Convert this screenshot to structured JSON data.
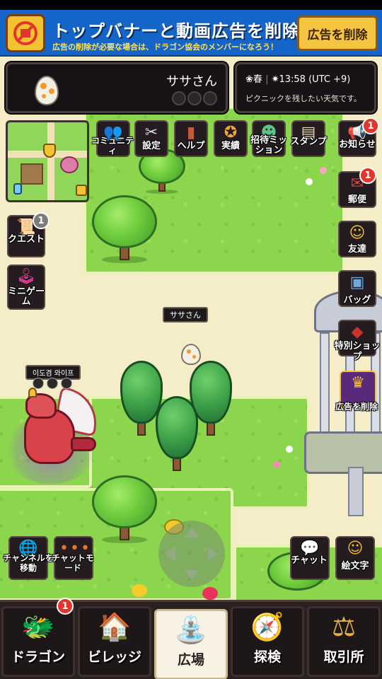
{
  "status_bar": {},
  "ad_banner": {
    "title": "トップバナーと動画広告を削除！",
    "subtitle": "広告の削除が必要な場合は、ドラゴン協会のメンバーになろう！",
    "remove_button": "広告を削除",
    "icon": "no-ads-icon"
  },
  "player": {
    "name": "ササさん",
    "avatar": "egg-icon",
    "map_tag": "ササさん"
  },
  "weather": {
    "season": "春",
    "time": "13:58 (UTC +9)",
    "description": "ピクニックを残したい天気です。"
  },
  "top_menu": [
    {
      "name": "community",
      "label": "コミュニティ",
      "icon": "people-icon"
    },
    {
      "name": "settings",
      "label": "設定",
      "icon": "tools-icon"
    },
    {
      "name": "help",
      "label": "ヘルプ",
      "icon": "book-icon"
    },
    {
      "name": "achievements",
      "label": "実績",
      "icon": "medal-icon"
    },
    {
      "name": "invite-mission",
      "label": "招待ミッション",
      "icon": "invite-icon"
    },
    {
      "name": "stamp",
      "label": "スタンプ",
      "icon": "stamp-icon"
    }
  ],
  "right_menu": [
    {
      "name": "notice",
      "label": "お知らせ",
      "icon": "megaphone-icon",
      "badge": "1"
    },
    {
      "name": "mail",
      "label": "郵便",
      "icon": "mailbox-icon",
      "badge": "1"
    },
    {
      "name": "friends",
      "label": "友達",
      "icon": "friends-icon"
    },
    {
      "name": "bag",
      "label": "バッグ",
      "icon": "backpack-icon"
    },
    {
      "name": "special-shop",
      "label": "特別ショップ",
      "icon": "treasure-icon"
    },
    {
      "name": "remove-ads",
      "label": "広告を削除",
      "icon": "crown-portrait-icon"
    }
  ],
  "left_menu": [
    {
      "name": "quest",
      "label": "クエスト",
      "icon": "scroll-icon",
      "badge": "1"
    },
    {
      "name": "minigame",
      "label": "ミニゲーム",
      "icon": "joystick-icon"
    }
  ],
  "npc": {
    "name": "이도겸 와이프"
  },
  "bottom_left": [
    {
      "name": "channel-move",
      "label": "チャンネルを移動",
      "icon": "globe-icon"
    },
    {
      "name": "chat-mode",
      "label": "チャットモード",
      "icon": "dots-icon"
    }
  ],
  "bottom_right": [
    {
      "name": "chat",
      "label": "チャット",
      "icon": "chat-bubble-icon"
    },
    {
      "name": "emoji",
      "label": "絵文字",
      "icon": "emoji-face-icon"
    }
  ],
  "bottom_nav": [
    {
      "name": "dragon",
      "label": "ドラゴン",
      "icon": "dragon-icon",
      "badge": "1"
    },
    {
      "name": "village",
      "label": "ビレッジ",
      "icon": "house-icon"
    },
    {
      "name": "plaza",
      "label": "広場",
      "icon": "fountain-icon",
      "active": true
    },
    {
      "name": "explore",
      "label": "探検",
      "icon": "compass-icon"
    },
    {
      "name": "trade",
      "label": "取引所",
      "icon": "scale-icon"
    }
  ],
  "colors": {
    "ad_blue": "#1565c8",
    "ad_yellow": "#f5c542",
    "badge_red": "#e0362c",
    "panel_dark": "#161216",
    "grass": "#8cd64e"
  }
}
